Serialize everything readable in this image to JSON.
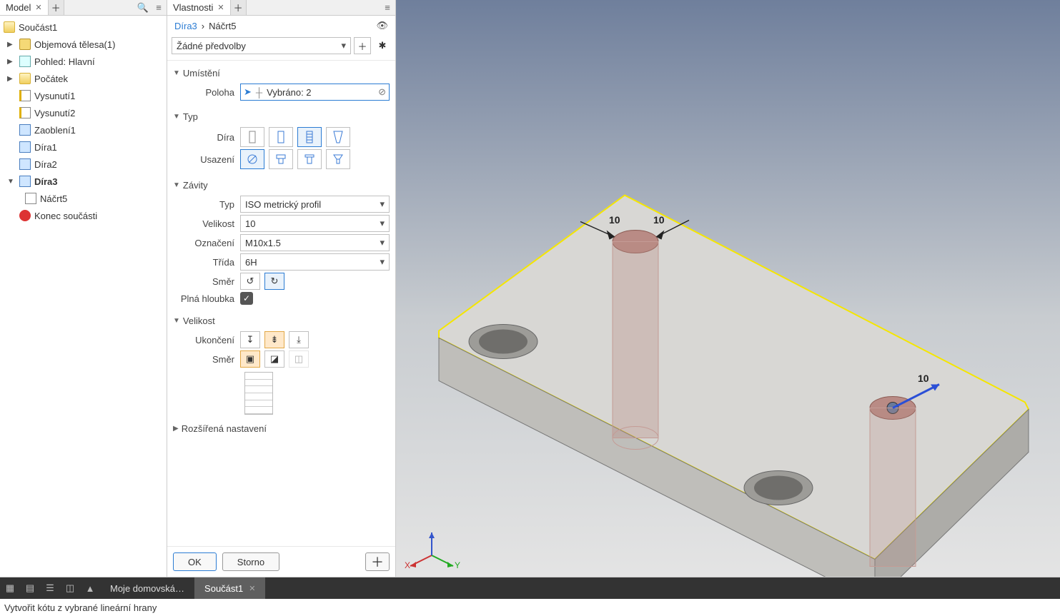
{
  "model_panel": {
    "tab": "Model",
    "root": "Součást1",
    "nodes": {
      "solids": "Objemová tělesa(1)",
      "view": "Pohled: Hlavní",
      "origin": "Počátek",
      "ext1": "Vysunutí1",
      "ext2": "Vysunutí2",
      "fillet": "Zaoblení1",
      "hole1": "Díra1",
      "hole2": "Díra2",
      "hole3": "Díra3",
      "sketch5": "Náčrt5",
      "end": "Konec součásti"
    }
  },
  "prop_panel": {
    "tab": "Vlastnosti",
    "crumb_link": "Díra3",
    "crumb_current": "Náčrt5",
    "crumb_sep": "›",
    "preset": "Žádné předvolby",
    "sections": {
      "placement": "Umístění",
      "type": "Typ",
      "threads": "Závity",
      "size": "Velikost",
      "advanced": "Rozšířená nastavení"
    },
    "labels": {
      "position": "Poloha",
      "hole": "Díra",
      "seat": "Usazení",
      "thr_type": "Typ",
      "thr_size": "Velikost",
      "thr_desig": "Označení",
      "thr_class": "Třída",
      "thr_dir": "Směr",
      "thr_full": "Plná hloubka",
      "termination": "Ukončení",
      "direction": "Směr"
    },
    "values": {
      "position": "Vybráno: 2",
      "thr_type": "ISO metrický profil",
      "thr_size": "10",
      "thr_desig": "M10x1.5",
      "thr_class": "6H"
    },
    "buttons": {
      "ok": "OK",
      "cancel": "Storno"
    }
  },
  "viewport": {
    "dims": {
      "d1": "10",
      "d2": "10",
      "d3": "10"
    },
    "axes": {
      "x": "X",
      "y": "Y"
    }
  },
  "bottom_bar": {
    "home": "Moje domovská…",
    "doc": "Součást1"
  },
  "status": "Vytvořit kótu z vybrané lineární hrany"
}
